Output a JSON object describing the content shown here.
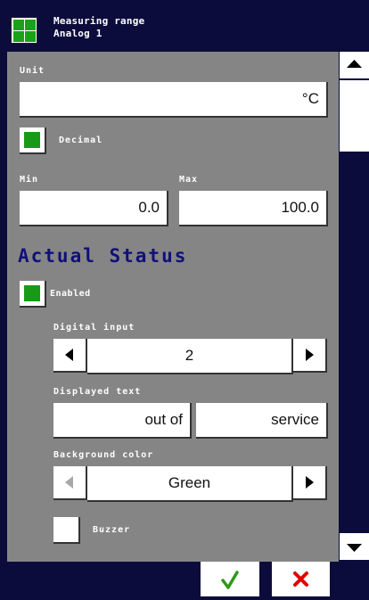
{
  "titlebar": {
    "title_line1": "Measuring range",
    "title_line2": "Analog 1",
    "icon": "grid-app-icon"
  },
  "unit": {
    "label": "Unit",
    "value": "°C"
  },
  "decimal": {
    "label": "Decimal",
    "checked": true
  },
  "range": {
    "min_label": "Min",
    "min_value": "0.0",
    "max_label": "Max",
    "max_value": "100.0"
  },
  "actual_status": {
    "heading": "Actual Status",
    "enabled_label": "Enabled",
    "enabled_checked": true,
    "digital_input_label": "Digital input",
    "digital_input_value": "2",
    "displayed_text_label": "Displayed text",
    "displayed_text_part1": "out of",
    "displayed_text_part2": "service",
    "background_color_label": "Background color",
    "background_color_value": "Green",
    "buzzer_label": "Buzzer",
    "buzzer_checked": false
  },
  "actions": {
    "confirm_icon": "checkmark-icon",
    "cancel_icon": "close-icon"
  },
  "colors": {
    "bar": "#0c0c3c",
    "panel": "#858585",
    "heading": "#10107a",
    "check_green": "#189a18",
    "confirm": "#2e9a1a",
    "cancel": "#e00000"
  }
}
